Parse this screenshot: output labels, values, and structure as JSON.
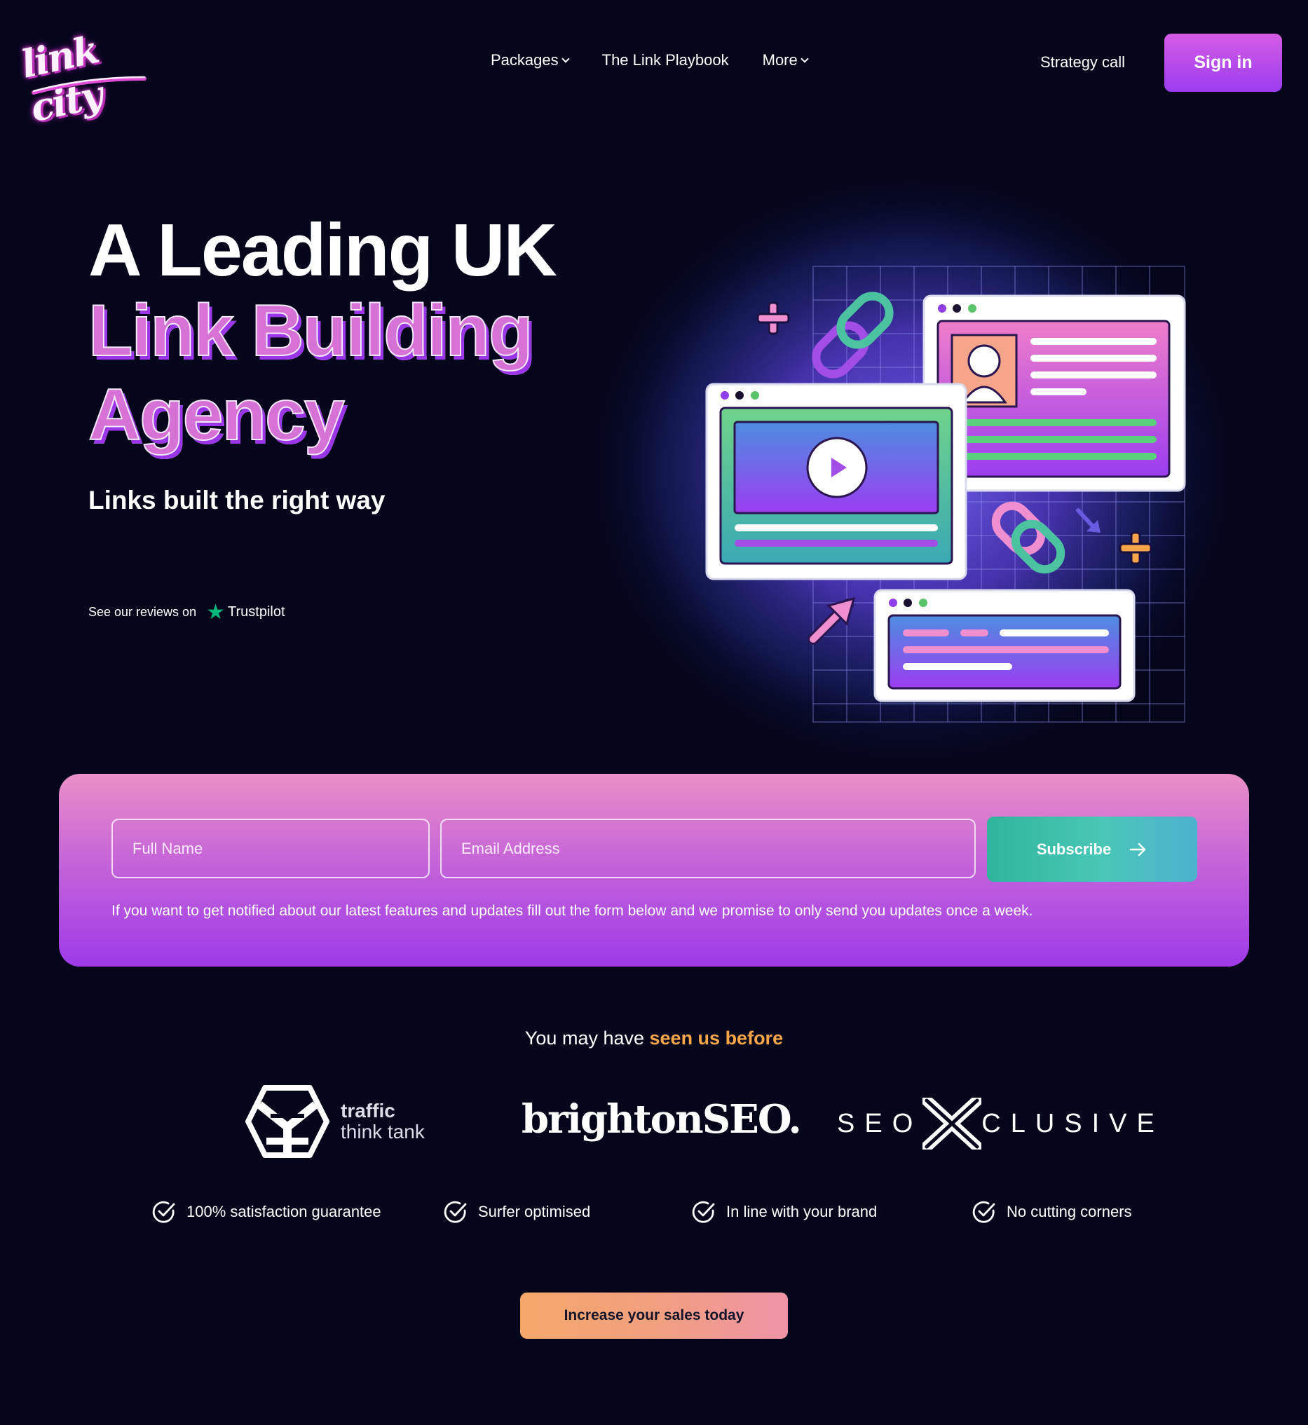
{
  "header": {
    "logo_text": "link city",
    "nav": [
      {
        "label": "Packages",
        "has_dropdown": true
      },
      {
        "label": "The Link Playbook",
        "has_dropdown": false
      },
      {
        "label": "More",
        "has_dropdown": true
      }
    ],
    "strategy_call": "Strategy call",
    "sign_in": "Sign in"
  },
  "hero": {
    "title_line1": "A Leading UK",
    "title_line2": "Link Building",
    "title_line3": "Agency",
    "subtitle": "Links built the right way",
    "reviews_prefix": "See our reviews on",
    "trustpilot": "Trustpilot"
  },
  "subscribe": {
    "name_placeholder": "Full Name",
    "email_placeholder": "Email Address",
    "button_label": "Subscribe",
    "note": "If you want to get notified about our latest features and updates fill out the form below and we promise to only send you updates once a week."
  },
  "seen": {
    "prefix": "You may have ",
    "highlight": "seen us before",
    "logos": {
      "ttt_line1": "traffic",
      "ttt_line2": "think tank",
      "brighton": "brightonSEO.",
      "seox_left": "SEO",
      "seox_right": "CLUSIVE"
    }
  },
  "features": [
    "100% satisfaction guarantee",
    "Surfer optimised",
    "In line with your brand",
    "No cutting corners"
  ],
  "cta": "Increase your sales today",
  "colors": {
    "background": "#05051c",
    "accent_purple": "#9b3df0",
    "accent_pink": "#ea8fc7",
    "accent_orange": "#f6a648",
    "accent_teal": "#2fb59b",
    "trustpilot_green": "#00b67a"
  },
  "icons": {
    "logo": "link-city-logo",
    "nav_dropdown": "chevron-down-icon",
    "subscribe_arrow": "arrow-right-icon",
    "trustpilot": "star-icon",
    "feature_check": "check-circle-icon"
  }
}
